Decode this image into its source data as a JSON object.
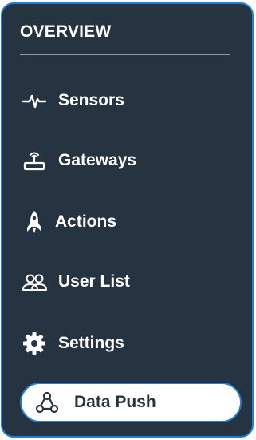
{
  "sidebar": {
    "section_title": "OVERVIEW",
    "items": [
      {
        "label": "Sensors",
        "icon": "pulse-icon"
      },
      {
        "label": "Gateways",
        "icon": "router-icon"
      },
      {
        "label": "Actions",
        "icon": "rocket-icon"
      },
      {
        "label": "User List",
        "icon": "users-icon"
      },
      {
        "label": "Settings",
        "icon": "gear-icon"
      },
      {
        "label": "Data Push",
        "icon": "webhook-icon",
        "active": true
      }
    ]
  },
  "colors": {
    "sidebar_bg": "#263340",
    "accent": "#1f7fd6",
    "text": "#ffffff",
    "active_bg": "#ffffff"
  }
}
